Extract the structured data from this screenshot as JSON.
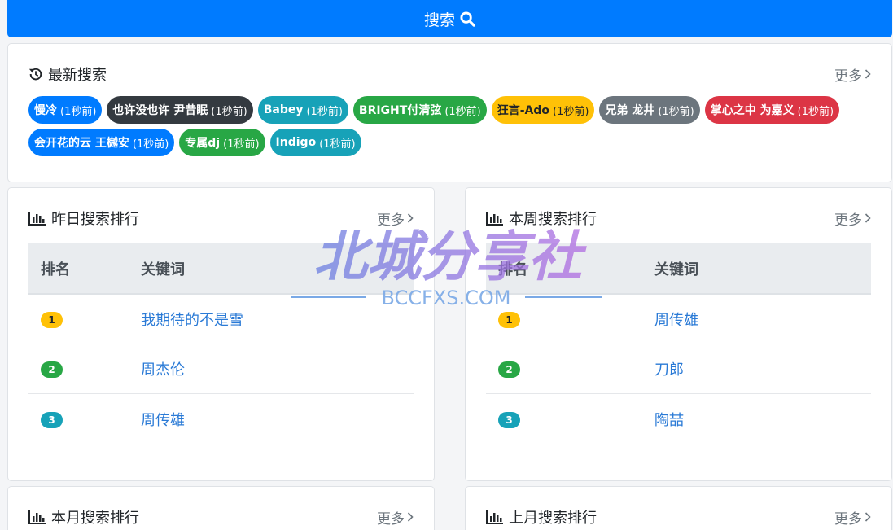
{
  "search": {
    "label": "搜索"
  },
  "latest": {
    "title": "最新搜索",
    "more": "更多",
    "tags": [
      {
        "kw": "慢冷",
        "ago": "(1秒前)",
        "color": "#007bff",
        "text": "#ffffff"
      },
      {
        "kw": "也许没也许 尹昔眠",
        "ago": "(1秒前)",
        "color": "#343a40",
        "text": "#ffffff"
      },
      {
        "kw": "Babey",
        "ago": "(1秒前)",
        "color": "#17a2b8",
        "text": "#ffffff"
      },
      {
        "kw": "BRIGHT付清弦",
        "ago": "(1秒前)",
        "color": "#28a745",
        "text": "#ffffff"
      },
      {
        "kw": "狂言-Ado",
        "ago": "(1秒前)",
        "color": "#ffc107",
        "text": "#212529"
      },
      {
        "kw": "兄弟 龙井",
        "ago": "(1秒前)",
        "color": "#6c757d",
        "text": "#ffffff"
      },
      {
        "kw": "掌心之中 为嘉义",
        "ago": "(1秒前)",
        "color": "#dc3545",
        "text": "#ffffff"
      },
      {
        "kw": "会开花的云 王樾安",
        "ago": "(1秒前)",
        "color": "#007bff",
        "text": "#ffffff"
      },
      {
        "kw": "专属dj",
        "ago": "(1秒前)",
        "color": "#28a745",
        "text": "#ffffff"
      },
      {
        "kw": "Indigo",
        "ago": "(1秒前)",
        "color": "#17a2b8",
        "text": "#ffffff"
      }
    ]
  },
  "yesterday": {
    "title": "昨日搜索排行",
    "more": "更多",
    "col_rank": "排名",
    "col_kw": "关键词",
    "rows": [
      {
        "rank": "1",
        "kw": "我期待的不是雪"
      },
      {
        "rank": "2",
        "kw": "周杰伦"
      },
      {
        "rank": "3",
        "kw": "周传雄"
      }
    ]
  },
  "week": {
    "title": "本周搜索排行",
    "more": "更多",
    "col_rank": "排名",
    "col_kw": "关键词",
    "rows": [
      {
        "rank": "1",
        "kw": "周传雄"
      },
      {
        "rank": "2",
        "kw": "刀郎"
      },
      {
        "rank": "3",
        "kw": "陶喆"
      }
    ]
  },
  "month": {
    "title": "本月搜索排行",
    "more": "更多"
  },
  "lastmonth": {
    "title": "上月搜索排行",
    "more": "更多"
  },
  "rank_colors": [
    "#ffc107",
    "#28a745",
    "#17a2b8"
  ],
  "watermark": {
    "main": "北城分享社",
    "sub": "BCCFXS.COM"
  }
}
